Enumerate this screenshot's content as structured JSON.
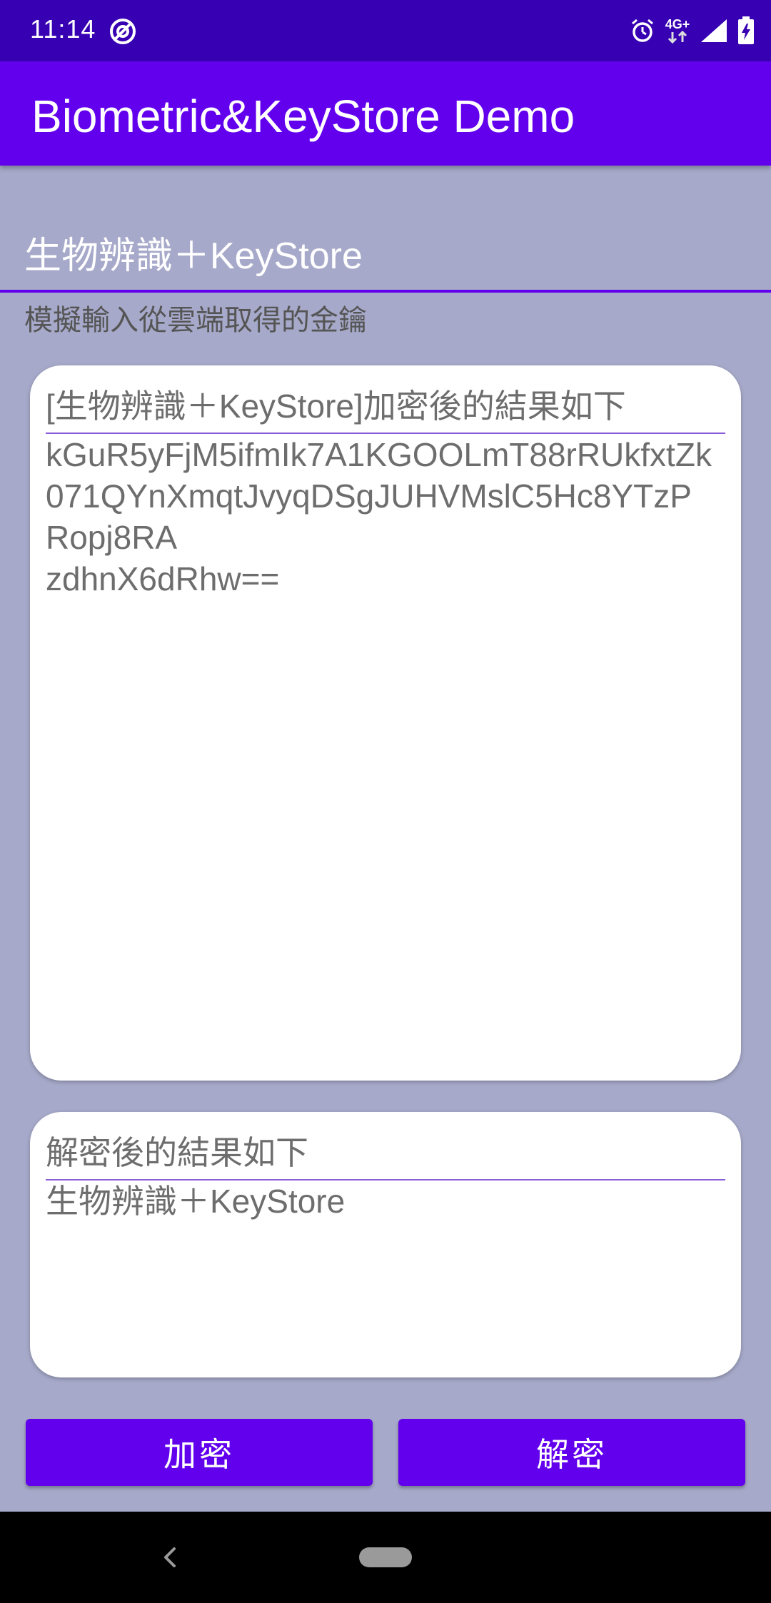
{
  "status_bar": {
    "time": "11:14",
    "network": "4G+",
    "icons": [
      "no-disturb-icon",
      "alarm-icon",
      "signal-icon",
      "battery-charging-icon"
    ]
  },
  "app_bar": {
    "title": "Biometric&KeyStore Demo"
  },
  "key_input": {
    "value": "生物辨識＋KeyStore",
    "hint": "模擬輸入從雲端取得的金鑰"
  },
  "encrypted_card": {
    "label": "[生物辨識＋KeyStore]加密後的結果如下",
    "lines": [
      "kGuR5yFjM5ifmIk7A1KGOOLmT88rRUkfxtZk",
      "071QYnXmqtJvyqDSgJUHVMslC5Hc8YTzP",
      "Ropj8RA",
      "zdhnX6dRhw=="
    ]
  },
  "decrypted_card": {
    "label": "解密後的結果如下",
    "value": "生物辨識＋KeyStore"
  },
  "buttons": {
    "encrypt": "加密",
    "decrypt": "解密"
  },
  "colors": {
    "status_bar": "#3700b3",
    "app_bar": "#6200ee",
    "background": "#a6a9c9",
    "card": "#ffffff",
    "button": "#6200ee"
  }
}
